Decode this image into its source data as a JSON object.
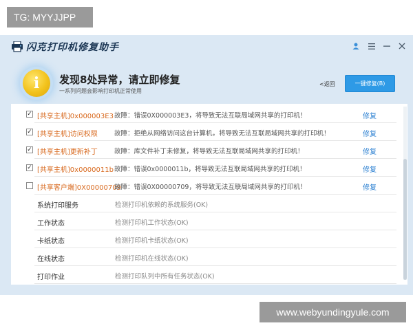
{
  "watermark_top": "TG: MYYJJPP",
  "watermark_bottom": "www.webyundingyule.com",
  "app": {
    "title": "闪克打印机修复助手"
  },
  "header": {
    "badge_glyph": "i",
    "headline": "发现8处异常，请立即修复",
    "subline": "一系列问题会影响打印机正常使用",
    "back_label": "<返回",
    "fix_all_label": "一键修复(B)"
  },
  "issues": [
    {
      "checked": true,
      "name": "[共享主机]0x000003E3",
      "desc": "故障：错误0X000003E3，将导致无法互联局域网共享的打印机！",
      "fix": "修复"
    },
    {
      "checked": true,
      "name": "[共享主机]访问权限",
      "desc": "故障：拒绝从网络访问这台计算机，将导致无法互联局域网共享的打印机！",
      "fix": "修复"
    },
    {
      "checked": true,
      "name": "[共享主机]更新补丁",
      "desc": "故障：库文件补丁未修复，将导致无法互联局域网共享的打印机！",
      "fix": "修复"
    },
    {
      "checked": true,
      "name": "[共享主机]0x0000011b",
      "desc": "故障：错误0x0000011b，将导致无法互联局域网共享的打印机！",
      "fix": "修复"
    },
    {
      "checked": false,
      "name": "[共享客户端]0X00000709",
      "desc": "故障：错误0X00000709，将导致无法互联局域网共享的打印机！",
      "fix": "修复"
    }
  ],
  "checks": [
    {
      "name": "系统打印服务",
      "desc": "检测打印机依赖的系统服务(OK)"
    },
    {
      "name": "工作状态",
      "desc": "检测打印机工作状态(OK)"
    },
    {
      "name": "卡纸状态",
      "desc": "检测打印机卡纸状态(OK)"
    },
    {
      "name": "在线状态",
      "desc": "检测打印机在线状态(OK)"
    },
    {
      "name": "打印作业",
      "desc": "检测打印队列中所有任务状态(OK)"
    }
  ],
  "colors": {
    "accent": "#2e9ae6",
    "issue_text": "#d8691e",
    "fix_link": "#2a7fd1",
    "window_bg": "#dbe8f4"
  }
}
